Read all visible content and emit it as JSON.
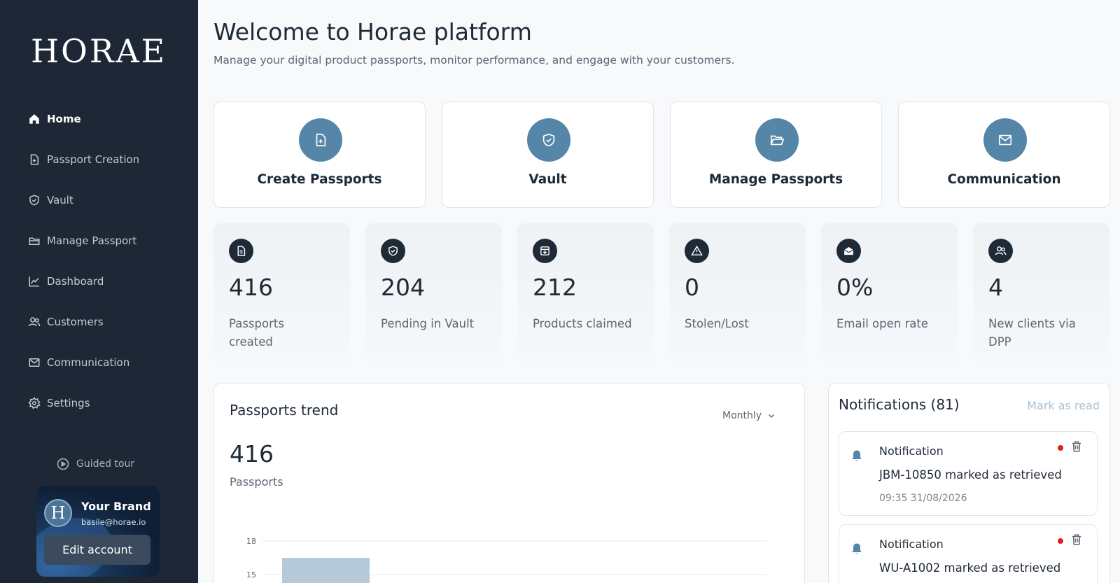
{
  "sidebar": {
    "logo": "HORAE",
    "items": [
      {
        "label": "Home",
        "icon": "home-icon",
        "active": true
      },
      {
        "label": "Passport Creation",
        "icon": "file-plus-icon"
      },
      {
        "label": "Vault",
        "icon": "shield-icon"
      },
      {
        "label": "Manage Passport",
        "icon": "folder-icon"
      },
      {
        "label": "Dashboard",
        "icon": "chart-line-icon"
      },
      {
        "label": "Customers",
        "icon": "users-icon"
      },
      {
        "label": "Communication",
        "icon": "mail-icon"
      },
      {
        "label": "Settings",
        "icon": "gear-icon"
      }
    ],
    "guided_tour": "Guided tour",
    "account": {
      "avatar_letter": "H",
      "name": "Your Brand",
      "email": "basile@horae.io",
      "edit_label": "Edit account"
    }
  },
  "header": {
    "title": "Welcome to Horae platform",
    "subtitle": "Manage your digital product passports, monitor performance, and engage with your customers."
  },
  "actions": [
    {
      "label": "Create Passports",
      "icon": "file-plus-icon"
    },
    {
      "label": "Vault",
      "icon": "shield-icon"
    },
    {
      "label": "Manage Passports",
      "icon": "folder-open-icon"
    },
    {
      "label": "Communication",
      "icon": "mail-icon"
    }
  ],
  "stats": [
    {
      "value": "416",
      "label": "Passports created",
      "icon": "document-icon"
    },
    {
      "value": "204",
      "label": "Pending in Vault",
      "icon": "shield-icon"
    },
    {
      "value": "212",
      "label": "Products claimed",
      "icon": "archive-icon"
    },
    {
      "value": "0",
      "label": "Stolen/Lost",
      "icon": "warning-icon"
    },
    {
      "value": "0%",
      "label": "Email open rate",
      "icon": "mail-open-icon"
    },
    {
      "value": "4",
      "label": "New clients via DPP",
      "icon": "users-icon"
    }
  ],
  "trend": {
    "title": "Passports trend",
    "period": "Monthly",
    "total": "416",
    "unit": "Passports"
  },
  "chart_data": {
    "type": "bar",
    "title": "Passports trend",
    "yticks": [
      18,
      15
    ],
    "visible_values": [
      16.5
    ],
    "bar_color": "#b5c9d8"
  },
  "notifications": {
    "title": "Notifications (81)",
    "mark_read": "Mark as read",
    "items": [
      {
        "head": "Notification",
        "message": "JBM-10850 marked as retrieved",
        "time": "09:35 31/08/2026"
      },
      {
        "head": "Notification",
        "message": "WU-A1002 marked as retrieved",
        "time": ""
      }
    ]
  },
  "colors": {
    "sidebar": "#1d2736",
    "accent": "#5586a8",
    "unread": "#e11d1d"
  }
}
